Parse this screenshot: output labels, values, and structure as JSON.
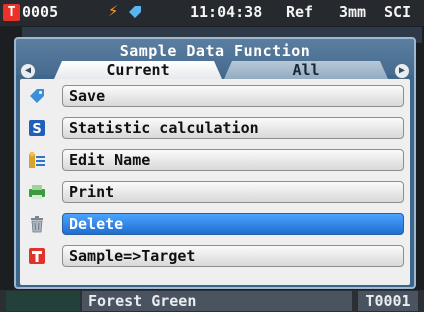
{
  "status": {
    "sample_id": "0005",
    "time": "11:04:38",
    "reference": "Ref",
    "aperture": "3mm",
    "mode": "SCI"
  },
  "dialog": {
    "title": "Sample Data Function",
    "tabs": [
      {
        "label": "Current",
        "active": true
      },
      {
        "label": "All",
        "active": false
      }
    ],
    "items": [
      {
        "label": "Save",
        "icon": "tag-icon",
        "selected": false
      },
      {
        "label": "Statistic calculation",
        "icon": "statistics-icon",
        "selected": false
      },
      {
        "label": "Edit Name",
        "icon": "edit-name-icon",
        "selected": false
      },
      {
        "label": "Print",
        "icon": "printer-icon",
        "selected": false
      },
      {
        "label": "Delete",
        "icon": "trash-icon",
        "selected": true
      },
      {
        "label": "Sample=>Target",
        "icon": "target-icon",
        "selected": false
      }
    ]
  },
  "bottom": {
    "name": "Forest Green",
    "code": "T0001"
  },
  "colors": {
    "accent": "#1f6ed0",
    "status_bg": "#262a2e",
    "selected_text": "#ffffff"
  }
}
